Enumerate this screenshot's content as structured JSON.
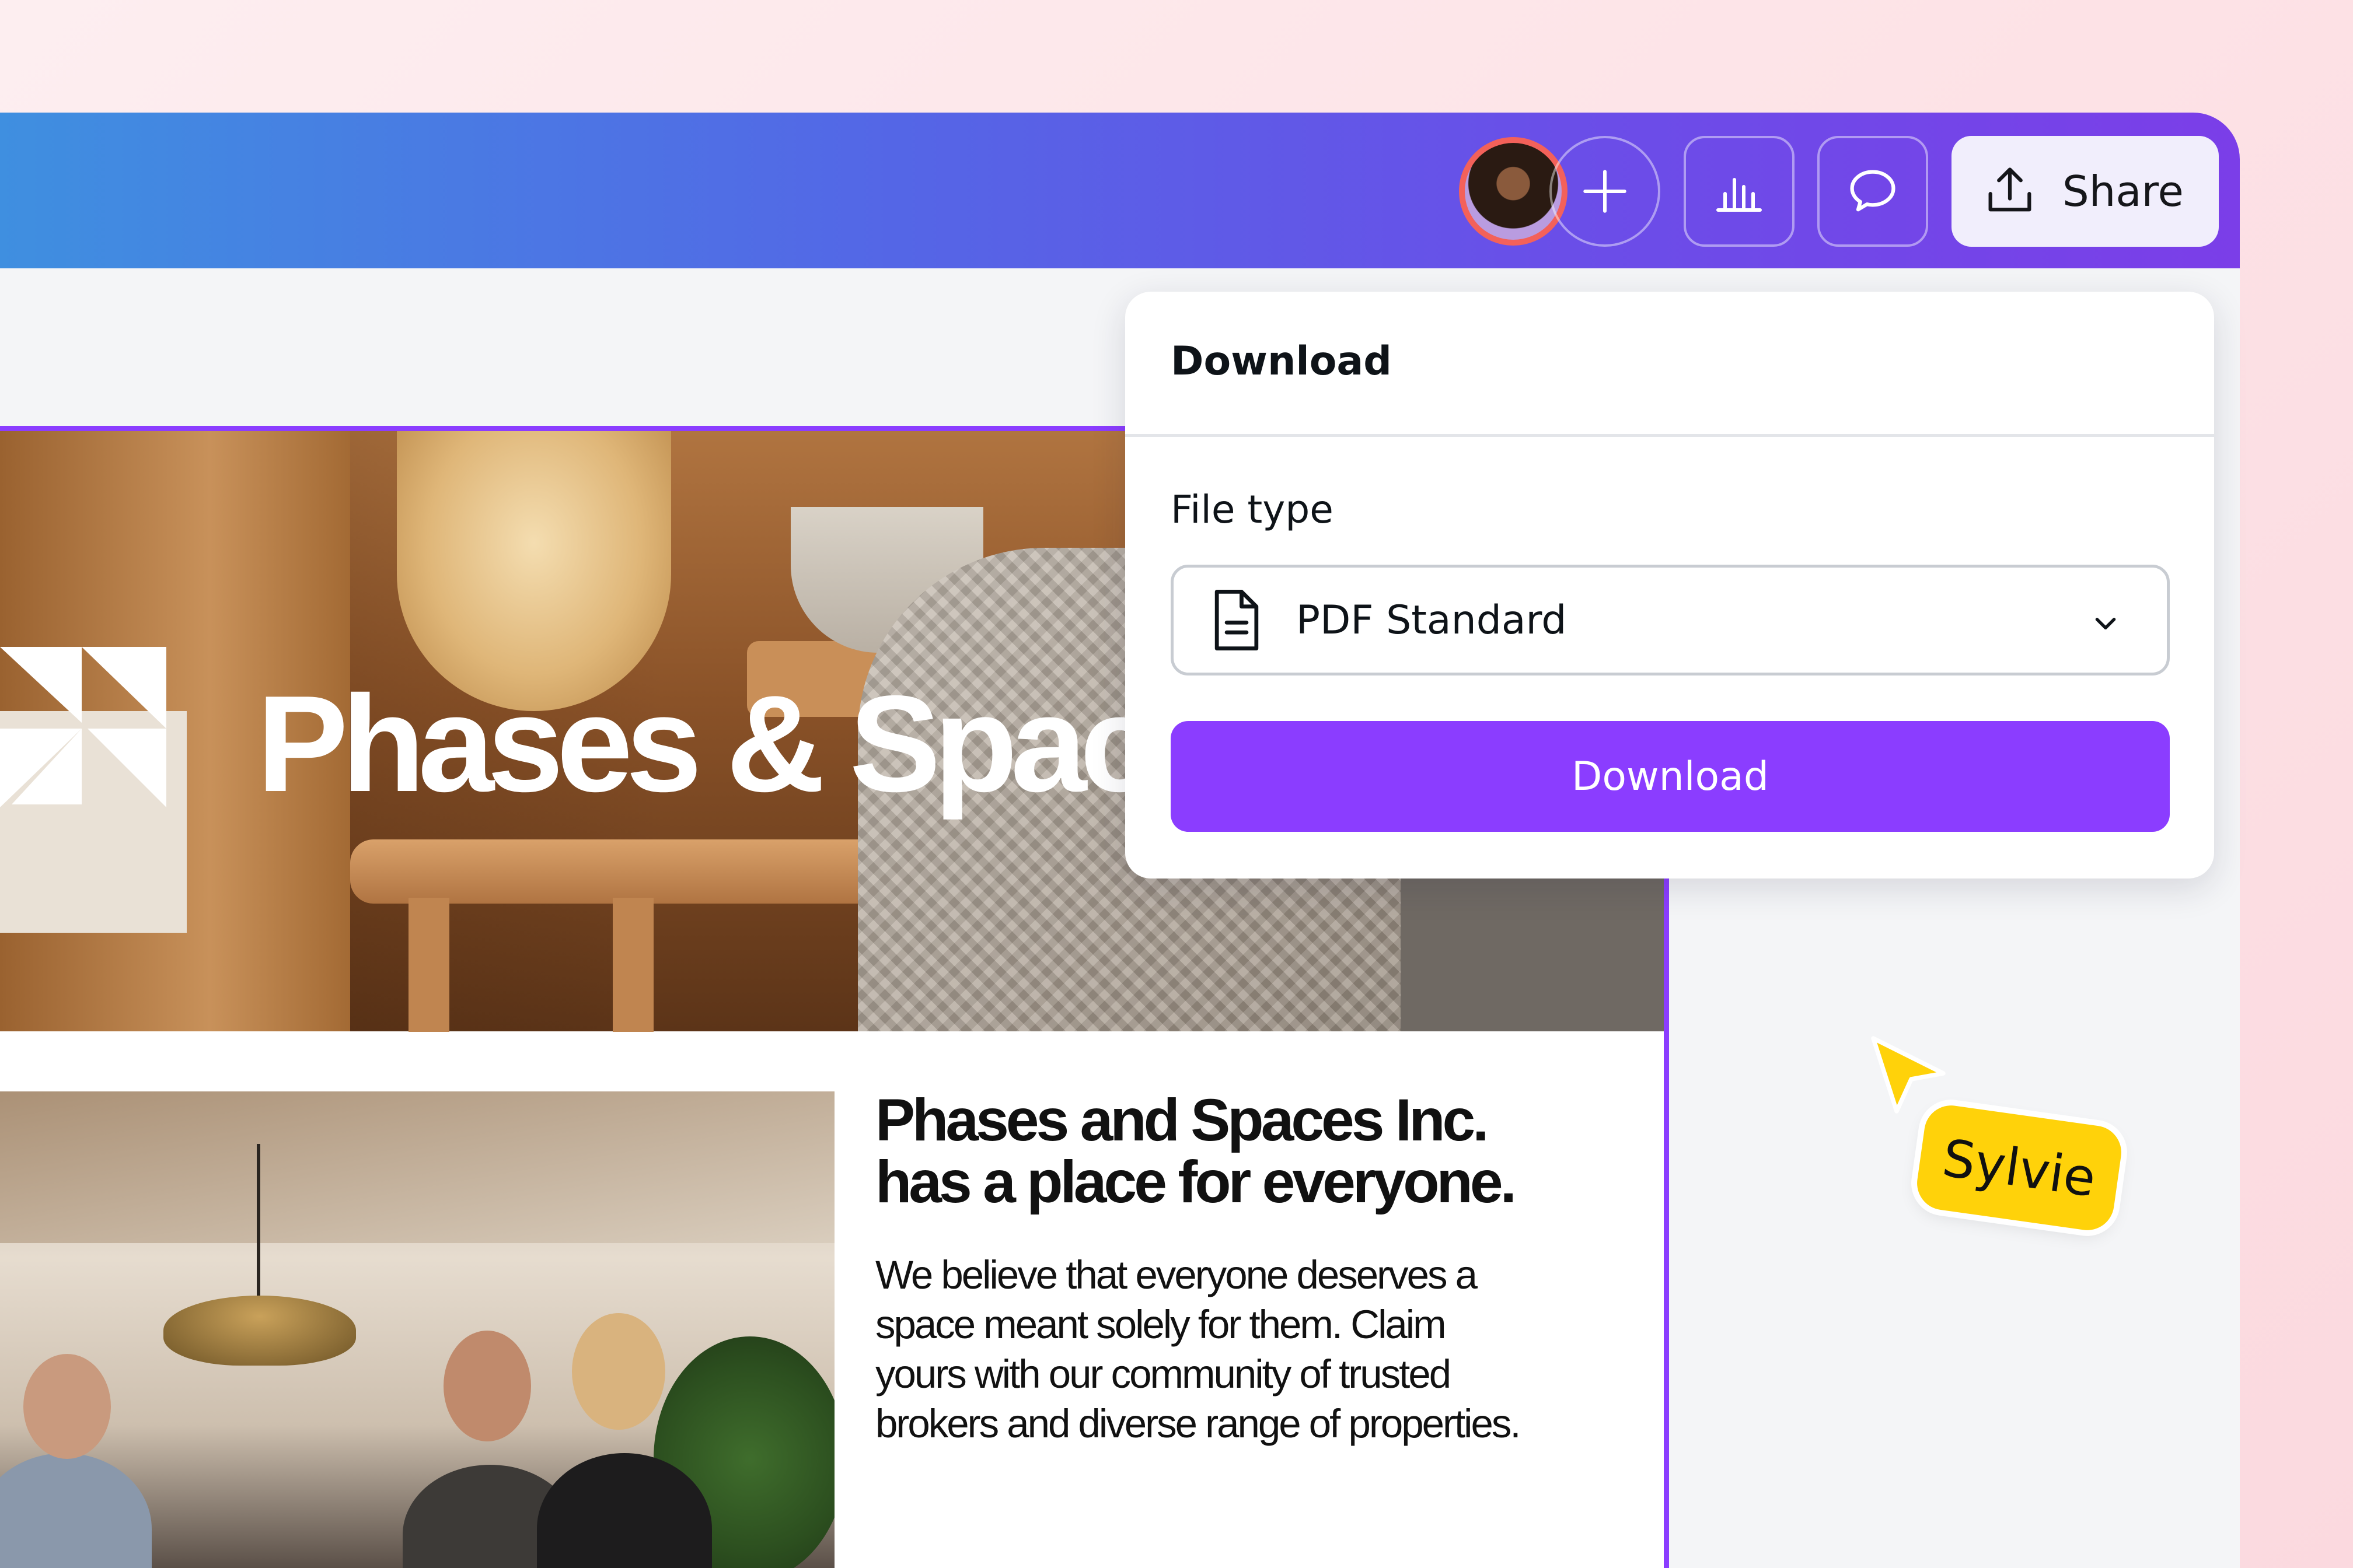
{
  "topbar": {
    "share_label": "Share",
    "avatar_alt": "Collaborator avatar",
    "icons": [
      "plus-icon",
      "analytics-icon",
      "comment-icon",
      "share-upload-icon"
    ]
  },
  "design": {
    "hero_title": "Phases & Spaces",
    "heading_line1": "Phases and Spaces Inc.",
    "heading_line2": "has a place for everyone.",
    "body_lines": [
      "We believe that everyone deserves a",
      "space meant solely for them. Claim",
      "yours with our community of trusted",
      "brokers and diverse range of properties."
    ]
  },
  "download_panel": {
    "title": "Download",
    "file_type_label": "File type",
    "file_type_value": "PDF Standard",
    "button_label": "Download"
  },
  "collaborator_cursor": {
    "name": "Sylvie",
    "color": "#ffd20a"
  },
  "colors": {
    "accent": "#8b3dff",
    "topbar_start": "#3f8fe0",
    "topbar_end": "#7b3ee8",
    "avatar_ring": "#f3615a"
  }
}
